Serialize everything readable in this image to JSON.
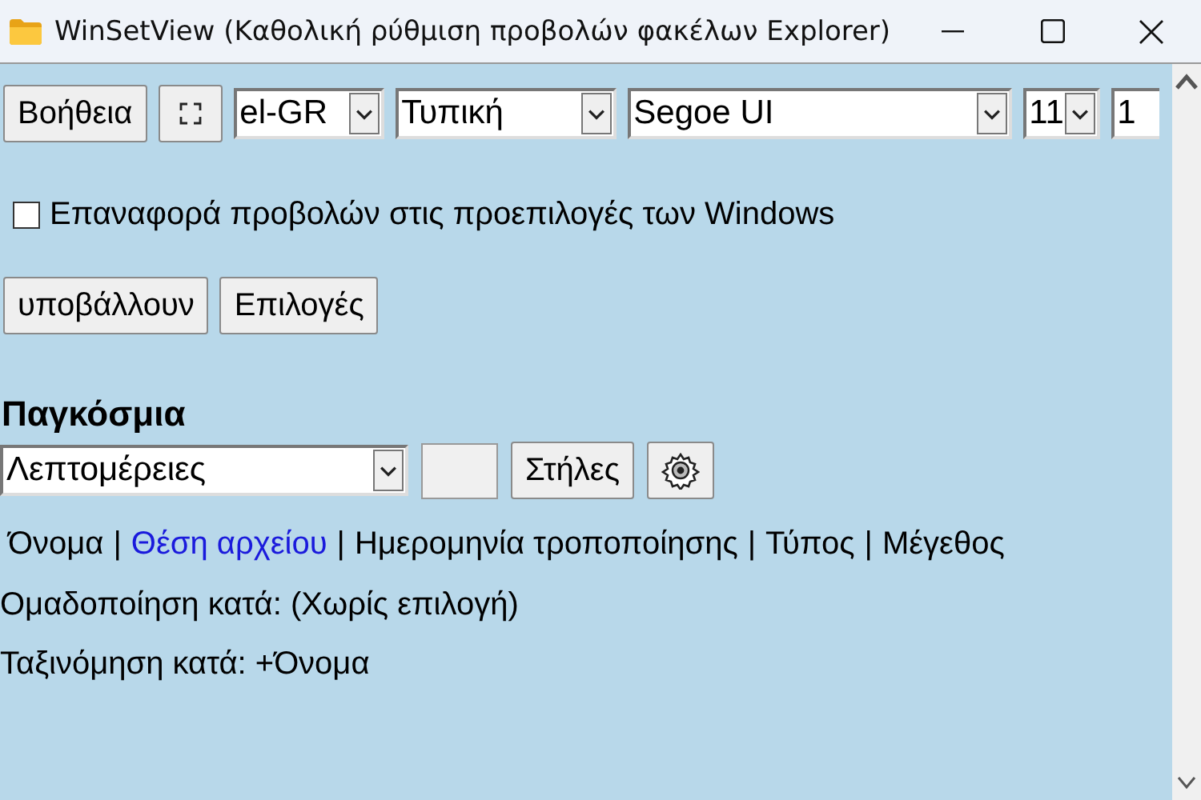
{
  "window": {
    "title": "WinSetView (Καθολική ρύθμιση προβολών φακέλων Explorer)"
  },
  "toolbar": {
    "help_button": "Βοήθεια",
    "language": "el-GR",
    "theme": "Τυπική",
    "font": "Segoe UI",
    "font_size": "11",
    "field_6": "1"
  },
  "reset_option": {
    "label": "Επαναφορά προβολών στις προεπιλογές των Windows",
    "checked": false
  },
  "actions": [
    "υποβάλλουν",
    "Επιλογές"
  ],
  "global": {
    "heading": "Παγκόσμια",
    "view": "Λεπτομέρειες",
    "columns_button": "Στήλες",
    "columns": [
      {
        "label": "Όνομα",
        "selected": false
      },
      {
        "label": "Θέση αρχείου",
        "selected": true
      },
      {
        "label": "Ημερομηνία τροποποίησης",
        "selected": false
      },
      {
        "label": "Τύπος",
        "selected": false
      },
      {
        "label": "Μέγεθος",
        "selected": false
      }
    ],
    "separators": [
      "|",
      "|",
      "|",
      "|"
    ],
    "group_by": "Ομαδοποίηση κατά: (Χωρίς επιλογή)",
    "sort_by": "Ταξινόμηση κατά: +Όνομα"
  }
}
